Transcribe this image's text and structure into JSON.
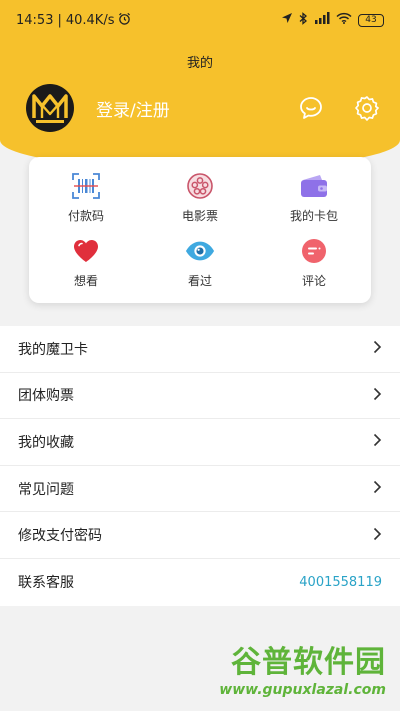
{
  "status_bar": {
    "time": "14:53",
    "speed": "40.4K/s",
    "battery": "43"
  },
  "header": {
    "title": "我的",
    "login_label": "登录/注册"
  },
  "quick_actions": [
    {
      "label": "付款码",
      "icon": "barcode-icon"
    },
    {
      "label": "电影票",
      "icon": "film-reel-icon"
    },
    {
      "label": "我的卡包",
      "icon": "wallet-icon"
    },
    {
      "label": "想看",
      "icon": "heart-icon"
    },
    {
      "label": "看过",
      "icon": "eye-icon"
    },
    {
      "label": "评论",
      "icon": "comment-icon"
    }
  ],
  "menu": [
    {
      "label": "我的魔卫卡"
    },
    {
      "label": "团体购票"
    },
    {
      "label": "我的收藏"
    },
    {
      "label": "常见问题"
    },
    {
      "label": "修改支付密码"
    },
    {
      "label": "联系客服",
      "value": "4001558119"
    }
  ],
  "watermark": {
    "main": "谷普软件园",
    "url": "www.gupuxlazal.com"
  },
  "colors": {
    "header": "#f6c12c",
    "link": "#2aa3c7",
    "watermark": "#5fb43a"
  }
}
